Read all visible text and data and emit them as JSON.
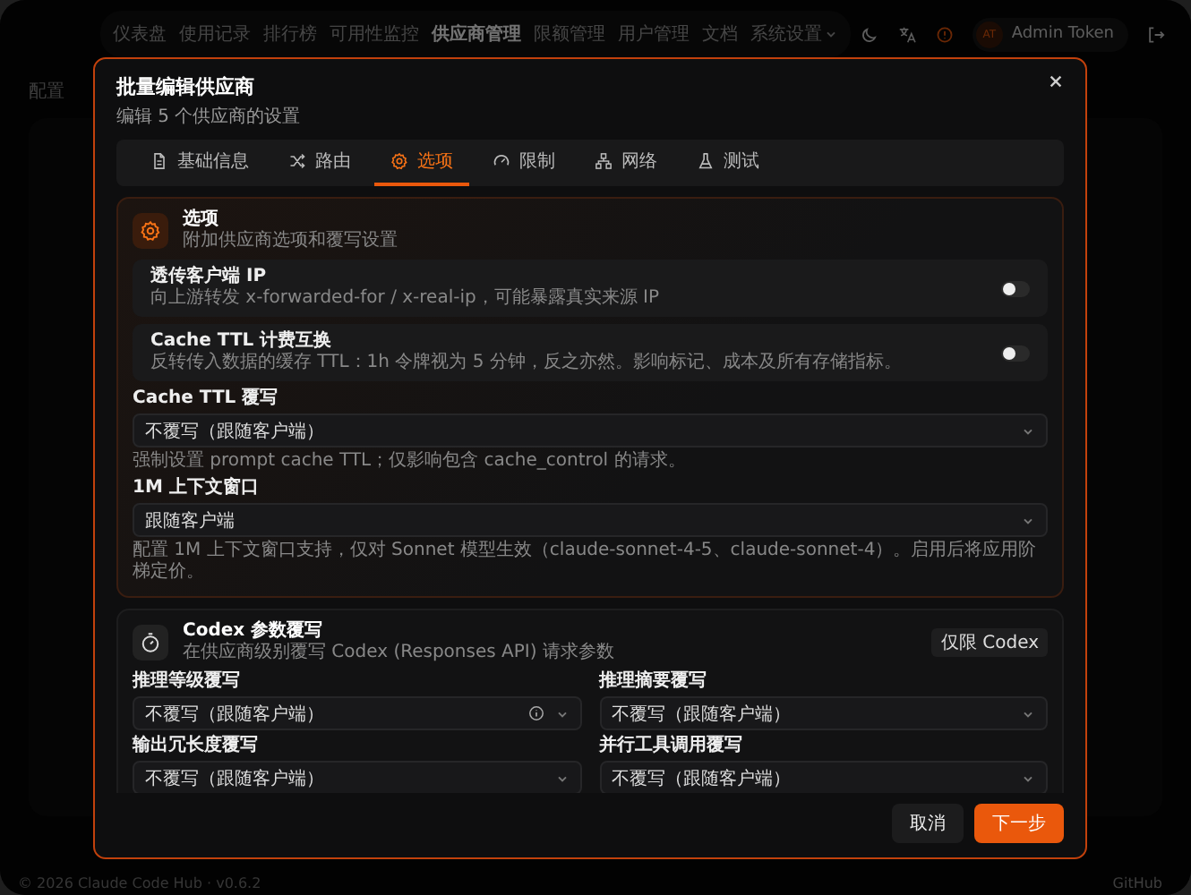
{
  "nav": {
    "items": [
      {
        "label": "仪表盘",
        "selected": false,
        "has_menu": false
      },
      {
        "label": "使用记录",
        "selected": false,
        "has_menu": false
      },
      {
        "label": "排行榜",
        "selected": false,
        "has_menu": false
      },
      {
        "label": "可用性监控",
        "selected": false,
        "has_menu": false
      },
      {
        "label": "供应商管理",
        "selected": true,
        "has_menu": false
      },
      {
        "label": "限额管理",
        "selected": false,
        "has_menu": false
      },
      {
        "label": "用户管理",
        "selected": false,
        "has_menu": false
      },
      {
        "label": "文档",
        "selected": false,
        "has_menu": false
      },
      {
        "label": "系统设置",
        "selected": false,
        "has_menu": true
      }
    ],
    "user": {
      "initials": "AT",
      "name": "Admin Token"
    }
  },
  "breadcrumb": "配置",
  "modal": {
    "title": "批量编辑供应商",
    "subtitle": "编辑 5 个供应商的设置",
    "tabs": [
      {
        "label": "基础信息",
        "selected": false
      },
      {
        "label": "路由",
        "selected": false
      },
      {
        "label": "选项",
        "selected": true
      },
      {
        "label": "限制",
        "selected": false
      },
      {
        "label": "网络",
        "selected": false
      },
      {
        "label": "测试",
        "selected": false
      }
    ],
    "sections": [
      {
        "title": "选项",
        "subtitle": "附加供应商选项和覆写设置",
        "toggles": [
          {
            "title": "透传客户端 IP",
            "description": "向上游转发 x-forwarded-for / x-real-ip，可能暴露真实来源 IP",
            "on": false
          },
          {
            "title": "Cache TTL 计费互换",
            "description": "反转传入数据的缓存 TTL：1h 令牌视为 5 分钟，反之亦然。影响标记、成本及所有存储指标。",
            "on": false
          }
        ],
        "selects": [
          {
            "label": "Cache TTL 覆写",
            "value": "不覆写（跟随客户端）",
            "help": "强制设置 prompt cache TTL；仅影响包含 cache_control 的请求。",
            "has_info": false
          },
          {
            "label": "1M 上下文窗口",
            "value": "跟随客户端",
            "help": "配置 1M 上下文窗口支持，仅对 Sonnet 模型生效（claude-sonnet-4-5、claude-sonnet-4）。启用后将应用阶梯定价。",
            "has_info": false
          }
        ]
      },
      {
        "title": "Codex 参数覆写",
        "subtitle": "在供应商级别覆写 Codex (Responses API) 请求参数",
        "badge": "仅限 Codex",
        "selects": [
          {
            "label": "推理等级覆写",
            "value": "不覆写（跟随客户端）",
            "has_info": true
          },
          {
            "label": "推理摘要覆写",
            "value": "不覆写（跟随客户端）",
            "has_info": false
          },
          {
            "label": "输出冗长度覆写",
            "value": "不覆写（跟随客户端）",
            "has_info": false
          },
          {
            "label": "并行工具调用覆写",
            "value": "不覆写（跟随客户端）",
            "has_info": false
          }
        ]
      }
    ],
    "buttons": [
      {
        "label": "取消",
        "kind": "secondary"
      },
      {
        "label": "下一步",
        "kind": "primary"
      }
    ]
  },
  "footer": {
    "copyright": "© 2026 Claude Code Hub · v0.6.2",
    "link": "GitHub"
  }
}
